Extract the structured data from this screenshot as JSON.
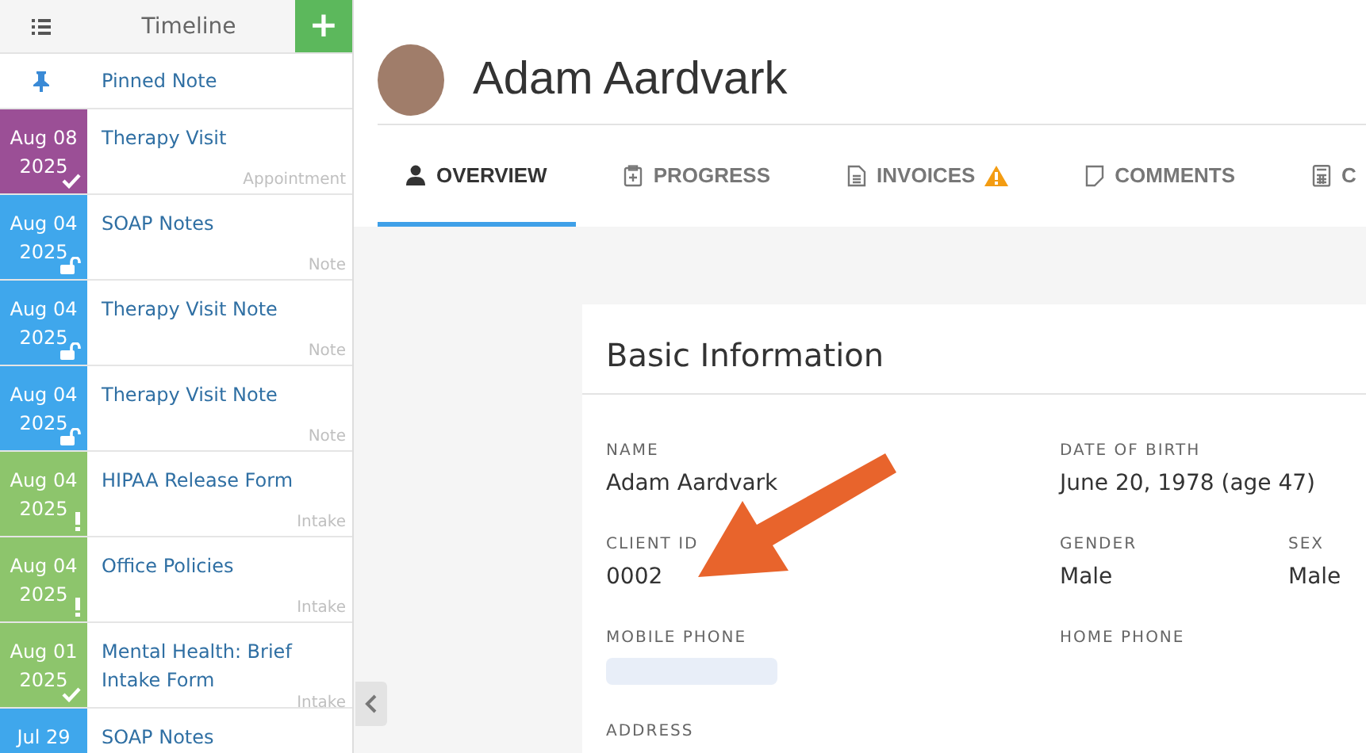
{
  "sidebar": {
    "title": "Timeline",
    "add_button": "+",
    "pinned": {
      "label": "Pinned Note"
    },
    "items": [
      {
        "date": "Aug 08",
        "year": "2025",
        "title": "Therapy Visit",
        "type": "Appointment",
        "color": "#9b4f96",
        "signed": true
      },
      {
        "date": "Aug 04",
        "year": "2025",
        "title": "SOAP Notes",
        "type": "Note",
        "color": "#3fa7ec",
        "locked": false
      },
      {
        "date": "Aug 04",
        "year": "2025",
        "title": "Therapy Visit Note",
        "type": "Note",
        "color": "#3fa7ec",
        "locked": false
      },
      {
        "date": "Aug 04",
        "year": "2025",
        "title": "Therapy Visit Note",
        "type": "Note",
        "color": "#3fa7ec",
        "locked": false
      },
      {
        "date": "Aug 04",
        "year": "2025",
        "title": "HIPAA Release Form",
        "type": "Intake",
        "color": "#8dc56c",
        "incomplete": true
      },
      {
        "date": "Aug 04",
        "year": "2025",
        "title": "Office Policies",
        "type": "Intake",
        "color": "#8dc56c",
        "incomplete": true
      },
      {
        "date": "Aug 01",
        "year": "2025",
        "title": "Mental Health: Brief Intake Form",
        "type": "Intake",
        "color": "#8dc56c",
        "signed": true
      },
      {
        "date": "Jul 29",
        "title": "SOAP Notes",
        "color": "#3fa7ec"
      }
    ]
  },
  "client": {
    "name": "Adam Aardvark"
  },
  "tabs": [
    {
      "label": "OVERVIEW",
      "selected": true
    },
    {
      "label": "PROGRESS",
      "selected": false
    },
    {
      "label": "INVOICES",
      "selected": false,
      "warning": true
    },
    {
      "label": "COMMENTS",
      "selected": false
    },
    {
      "label": "C",
      "selected": false
    }
  ],
  "card": {
    "title": "Basic Information",
    "rows": [
      [
        {
          "label": "NAME",
          "value": "Adam Aardvark"
        },
        {
          "label": "DATE OF BIRTH",
          "value": "June 20, 1978  (age 47)"
        }
      ],
      [
        {
          "label": "CLIENT ID",
          "value": "0002"
        },
        {
          "label": "GENDER",
          "value": "Male"
        },
        {
          "label": "SEX",
          "value": "Male"
        }
      ],
      [
        {
          "label": "MOBILE PHONE",
          "blurred": true
        },
        {
          "label": "HOME PHONE"
        }
      ],
      [
        {
          "label": "ADDRESS"
        }
      ]
    ]
  }
}
